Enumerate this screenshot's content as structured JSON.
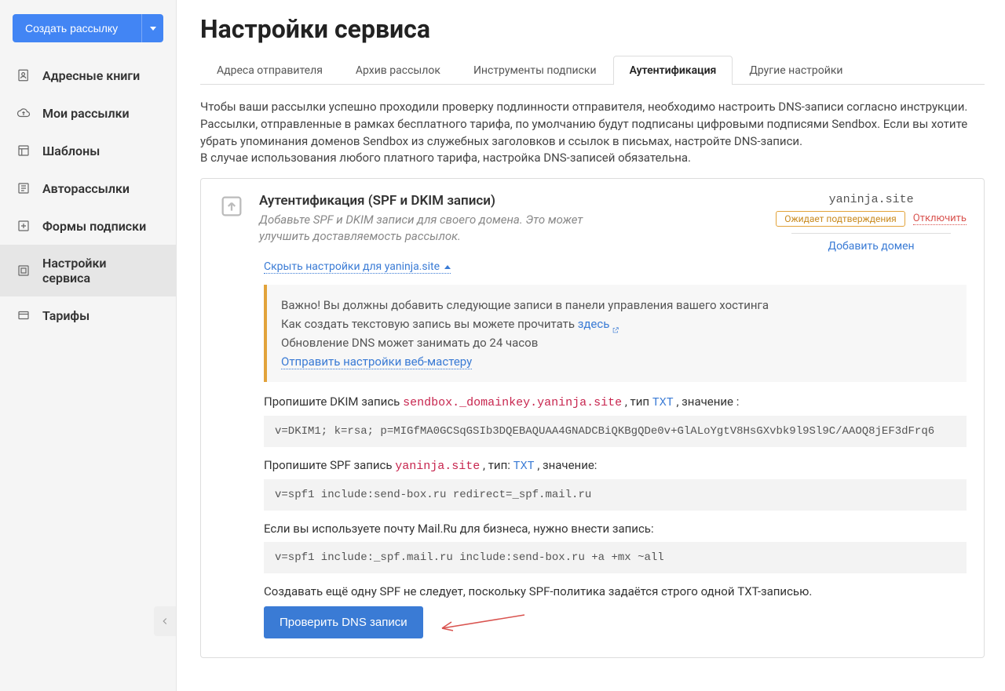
{
  "sidebar": {
    "create_label": "Создать рассылку",
    "items": [
      {
        "label": "Адресные книги"
      },
      {
        "label": "Мои рассылки"
      },
      {
        "label": "Шаблоны"
      },
      {
        "label": "Авторассылки"
      },
      {
        "label": "Формы подписки"
      },
      {
        "label": "Настройки сервиса"
      },
      {
        "label": "Тарифы"
      }
    ]
  },
  "page": {
    "title": "Настройки сервиса",
    "intro_line1": "Чтобы ваши рассылки успешно проходили проверку подлинности отправителя, необходимо настроить DNS-записи согласно инструкции.",
    "intro_line2": "Рассылки, отправленные в рамках бесплатного тарифа, по умолчанию будут подписаны цифровыми подписями Sendbox. Если вы хотите убрать упоминания доменов Sendbox из служебных заголовков и ссылок в письмах, настройте DNS-записи.",
    "intro_line3": "В случае использования любого платного тарифа, настройка DNS-записей обязательна."
  },
  "tabs": [
    {
      "label": "Адреса отправителя"
    },
    {
      "label": "Архив рассылок"
    },
    {
      "label": "Инструменты подписки"
    },
    {
      "label": "Аутентификация"
    },
    {
      "label": "Другие настройки"
    }
  ],
  "card": {
    "title": "Аутентификация (SPF и DKIM записи)",
    "sub": "Добавьте SPF и DKIM записи для своего домена. Это может улучшить доставляемость рассылок.",
    "domain": "yaninja.site",
    "badge_wait": "Ожидает подтверждения",
    "disable": "Отключить",
    "add_domain": "Добавить домен",
    "toggle": "Скрыть настройки для yaninja.site"
  },
  "alert": {
    "line1": "Важно! Вы должны добавить следующие записи в панели управления вашего хостинга",
    "line2_a": "Как создать текстовую запись вы можете прочитать ",
    "line2_link": "здесь",
    "line3": "Обновление DNS может занимать до 24 часов",
    "line4": "Отправить настройки веб-мастеру"
  },
  "dkim": {
    "label_a": "Пропишите DKIM запись ",
    "host": "sendbox._domainkey.yaninja.site",
    "label_b": " , тип ",
    "type": "TXT",
    "label_c": " , значение :",
    "value": "v=DKIM1; k=rsa; p=MIGfMA0GCSqGSIb3DQEBAQUAA4GNADCBiQKBgQDe0v+GlALoYgtV8HsGXvbk9l9Sl9C/AAOQ8jEF3dFrq6"
  },
  "spf": {
    "label_a": "Пропишите SPF запись ",
    "host": "yaninja.site",
    "label_b": " , тип: ",
    "type": "TXT",
    "label_c": " , значение:",
    "value": "v=spf1 include:send-box.ru redirect=_spf.mail.ru",
    "mailru_label": "Если вы используете почту Mail.Ru для бизнеса, нужно внести запись:",
    "mailru_value": "v=spf1 include:_spf.mail.ru include:send-box.ru +a +mx ~all",
    "note": "Создавать ещё одну SPF не следует, поскольку SPF-политика задаётся строго одной TXT-записью."
  },
  "actions": {
    "check": "Проверить DNS записи"
  }
}
